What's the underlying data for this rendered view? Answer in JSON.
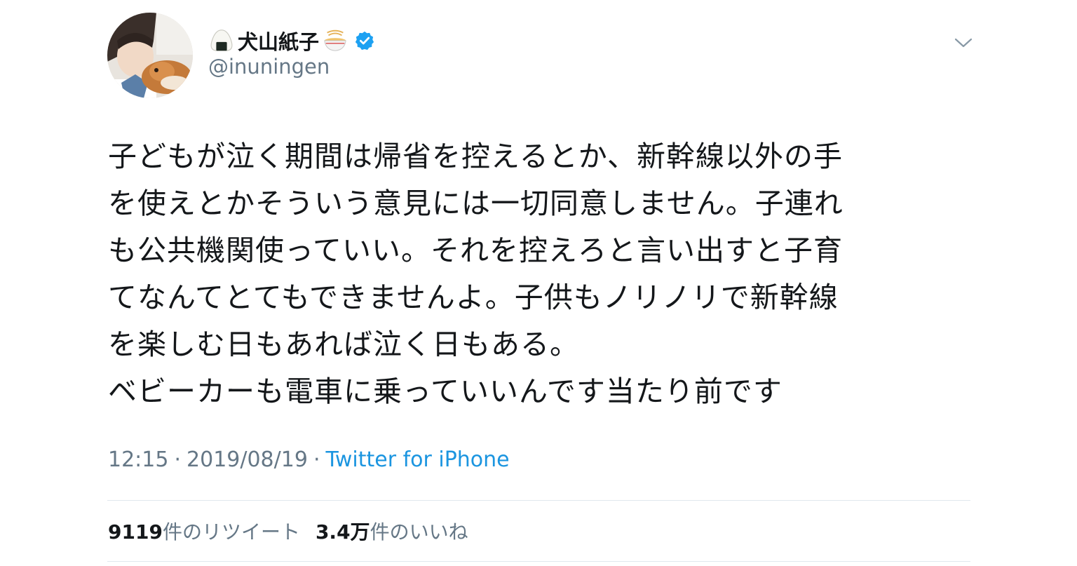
{
  "author": {
    "display_name": "犬山紙子",
    "name_prefix_icon": "rice-ball-icon",
    "name_suffix_icon": "ramen-bowl-icon",
    "verified": true,
    "handle": "@inuningen"
  },
  "tweet": {
    "lines": [
      "子どもが泣く期間は帰省を控えるとか、新幹線以外の手",
      "を使えとかそういう意見には一切同意しません。子連れ",
      "も公共機関使っていい。それを控えろと言い出すと子育",
      "てなんてとてもできませんよ。子供もノリノリで新幹線",
      "を楽しむ日もあれば泣く日もある。",
      "ベビーカーも電車に乗っていいんです当たり前です"
    ],
    "time": "12:15",
    "separator": "·",
    "date": "2019/08/19",
    "source": "Twitter for iPhone"
  },
  "stats": {
    "retweet_count": "9119",
    "retweet_label": "件のリツイート",
    "like_count": "3.4万",
    "like_label": "件のいいね"
  },
  "colors": {
    "text": "#14171a",
    "secondary": "#657786",
    "link": "#1b95e0",
    "verified": "#1da1f2",
    "divider": "#e1e8ed"
  }
}
